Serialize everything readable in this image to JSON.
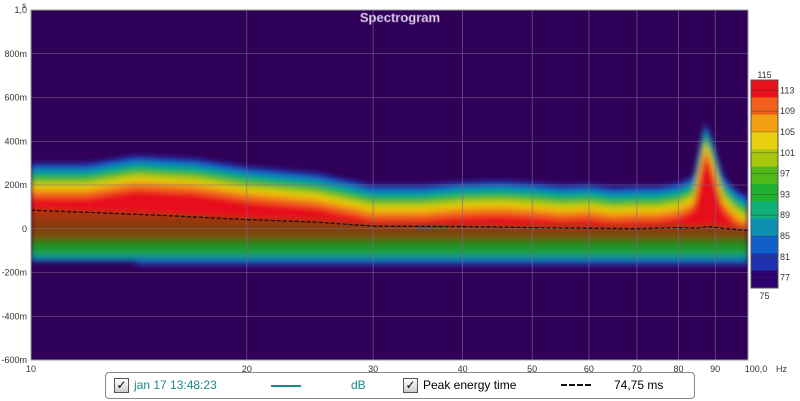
{
  "chart_data": {
    "type": "heatmap",
    "title": "Spectrogram",
    "xlabel": "Hz",
    "ylabel": "s",
    "x_scale": "log",
    "xlim": [
      10,
      100
    ],
    "ylim": [
      -0.6,
      1.0
    ],
    "x_ticks": [
      "10",
      "20",
      "30",
      "40",
      "50",
      "60",
      "70",
      "80",
      "90",
      "100,0"
    ],
    "x_tick_values": [
      10,
      20,
      30,
      40,
      50,
      60,
      70,
      80,
      90,
      100
    ],
    "y_ticks": [
      "1,0",
      "800m",
      "600m",
      "400m",
      "200m",
      "0",
      "-200m",
      "-400m",
      "-600m"
    ],
    "y_tick_values": [
      1.0,
      0.8,
      0.6,
      0.4,
      0.2,
      0,
      -0.2,
      -0.4,
      -0.6
    ],
    "y_unit": "s",
    "colorbar": {
      "min": 75,
      "max": 115,
      "ticks": [
        "113",
        "109",
        "105",
        "101",
        "97",
        "93",
        "89",
        "85",
        "81",
        "77"
      ],
      "min_label": "75",
      "max_label": "115",
      "colors": [
        "#e8101a",
        "#f0601a",
        "#f0a010",
        "#e8d010",
        "#a8c810",
        "#50b818",
        "#20b030",
        "#10b078",
        "#1090b0",
        "#1060c8",
        "#2030b0",
        "#300070"
      ]
    },
    "energy_envelope_ms": [
      [
        10,
        300
      ],
      [
        12,
        300
      ],
      [
        14,
        335
      ],
      [
        17,
        320
      ],
      [
        20,
        285
      ],
      [
        25,
        255
      ],
      [
        30,
        200
      ],
      [
        35,
        200
      ],
      [
        40,
        215
      ],
      [
        45,
        220
      ],
      [
        50,
        212
      ],
      [
        55,
        200
      ],
      [
        60,
        205
      ],
      [
        65,
        190
      ],
      [
        70,
        195
      ],
      [
        75,
        195
      ],
      [
        80,
        210
      ],
      [
        84,
        240
      ],
      [
        87,
        490
      ],
      [
        89,
        420
      ],
      [
        92,
        250
      ],
      [
        96,
        180
      ],
      [
        100,
        150
      ]
    ],
    "peak_energy_time_ms": [
      [
        10,
        85
      ],
      [
        12,
        75
      ],
      [
        15,
        62
      ],
      [
        20,
        42
      ],
      [
        25,
        30
      ],
      [
        30,
        12
      ],
      [
        40,
        10
      ],
      [
        50,
        5
      ],
      [
        60,
        2
      ],
      [
        70,
        0
      ],
      [
        80,
        5
      ],
      [
        85,
        2
      ],
      [
        88,
        10
      ],
      [
        92,
        2
      ],
      [
        100,
        -8
      ]
    ]
  },
  "legend": {
    "series1_label": "jan 17 13:48:23",
    "series1_unit": "dB",
    "series1_color": "#1a8a8a",
    "series2_label": "Peak energy time",
    "series2_value": "74,75 ms",
    "check": "✓"
  }
}
